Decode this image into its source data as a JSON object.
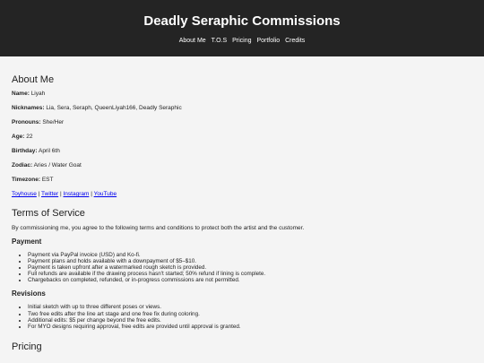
{
  "header": {
    "title": "Deadly Seraphic Commissions",
    "nav": [
      "About Me",
      "T.O.S",
      "Pricing",
      "Portfolio",
      "Credits"
    ]
  },
  "about": {
    "heading": "About Me",
    "fields": [
      {
        "label": "Name:",
        "value": "Liyah"
      },
      {
        "label": "Nicknames:",
        "value": "Lia, Sera, Seraph, QueenLiyah166, Deadly Seraphic"
      },
      {
        "label": "Pronouns:",
        "value": "She/Her"
      },
      {
        "label": "Age:",
        "value": "22"
      },
      {
        "label": "Birthday:",
        "value": "April 6th"
      },
      {
        "label": "Zodiac:",
        "value": "Aries / Water Goat"
      },
      {
        "label": "Timezone:",
        "value": "EST"
      }
    ],
    "links": [
      "Toyhouse",
      "Twitter",
      "Instagram",
      "YouTube"
    ]
  },
  "tos": {
    "heading": "Terms of Service",
    "intro": "By commissioning me, you agree to the following terms and conditions to protect both the artist and the customer.",
    "payment": {
      "heading": "Payment",
      "items": [
        "Payment via PayPal invoice (USD) and Ko-fi.",
        "Payment plans and holds available with a downpayment of $5–$10.",
        "Payment is taken upfront after a watermarked rough sketch is provided.",
        "Full refunds are available if the drawing process hasn't started; 50% refund if lining is complete.",
        "Chargebacks on completed, refunded, or in-progress commissions are not permitted."
      ]
    },
    "revisions": {
      "heading": "Revisions",
      "items": [
        "Initial sketch with up to three different poses or views.",
        "Two free edits after the line art stage and one free fix during coloring.",
        "Additional edits: $5 per change beyond the free edits.",
        "For MYO designs requiring approval, free edits are provided until approval is granted."
      ]
    }
  },
  "pricing": {
    "heading": "Pricing"
  }
}
